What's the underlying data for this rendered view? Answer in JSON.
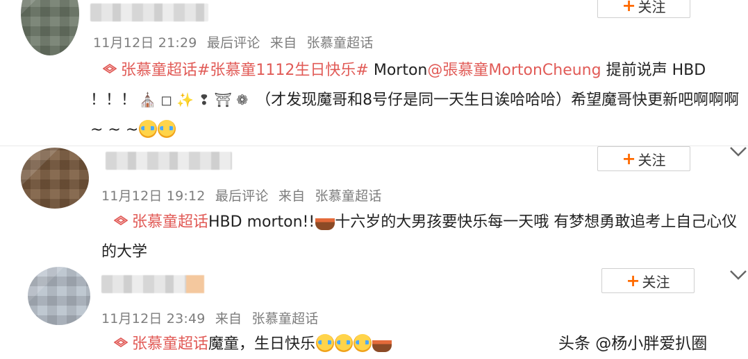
{
  "follow_label": "关注",
  "comments": [
    {
      "time": "11月12日 21:29",
      "last_comment": "最后评论",
      "from": "来自",
      "source": "张慕童超话",
      "tag_text": "张慕童超话#张慕童1112生日快乐#",
      "text_1": " Morton",
      "mention": "@張慕童MortonCheung",
      "text_2": " 提前说声 HBD ！！！",
      "symbols": "⛪ ◻ ✨ ❢ ⛩ ❁",
      "text_3": " （才发现魔哥和8号仔是同一天生日诶哈哈哈）希望魔哥快更新吧啊啊啊 ~ ~ ~",
      "emojis": [
        "crying-face",
        "crying-face"
      ]
    },
    {
      "time": "11月12日 19:12",
      "last_comment": "最后评论",
      "from": "来自",
      "source": "张慕童超话",
      "tag_text": "张慕童超话",
      "text_1": "HBD morton!!",
      "text_2": "十六岁的大男孩要快乐每一天哦 有梦想勇敢追考上自己心仪的大学",
      "emojis": [
        "cake"
      ]
    },
    {
      "time": "11月12日 23:49",
      "from": "来自",
      "source": "张慕童超话",
      "tag_text": "张慕童超话",
      "text_1": "魔童，生日快乐",
      "emojis": [
        "crying-face",
        "crying-face",
        "crying-face",
        "cake"
      ]
    }
  ],
  "watermark": "头条 @杨小胖爱扒圈",
  "colors": {
    "tag": "#e15b57",
    "meta": "#7d7d7d",
    "follow_plus": "#ff6a00"
  }
}
